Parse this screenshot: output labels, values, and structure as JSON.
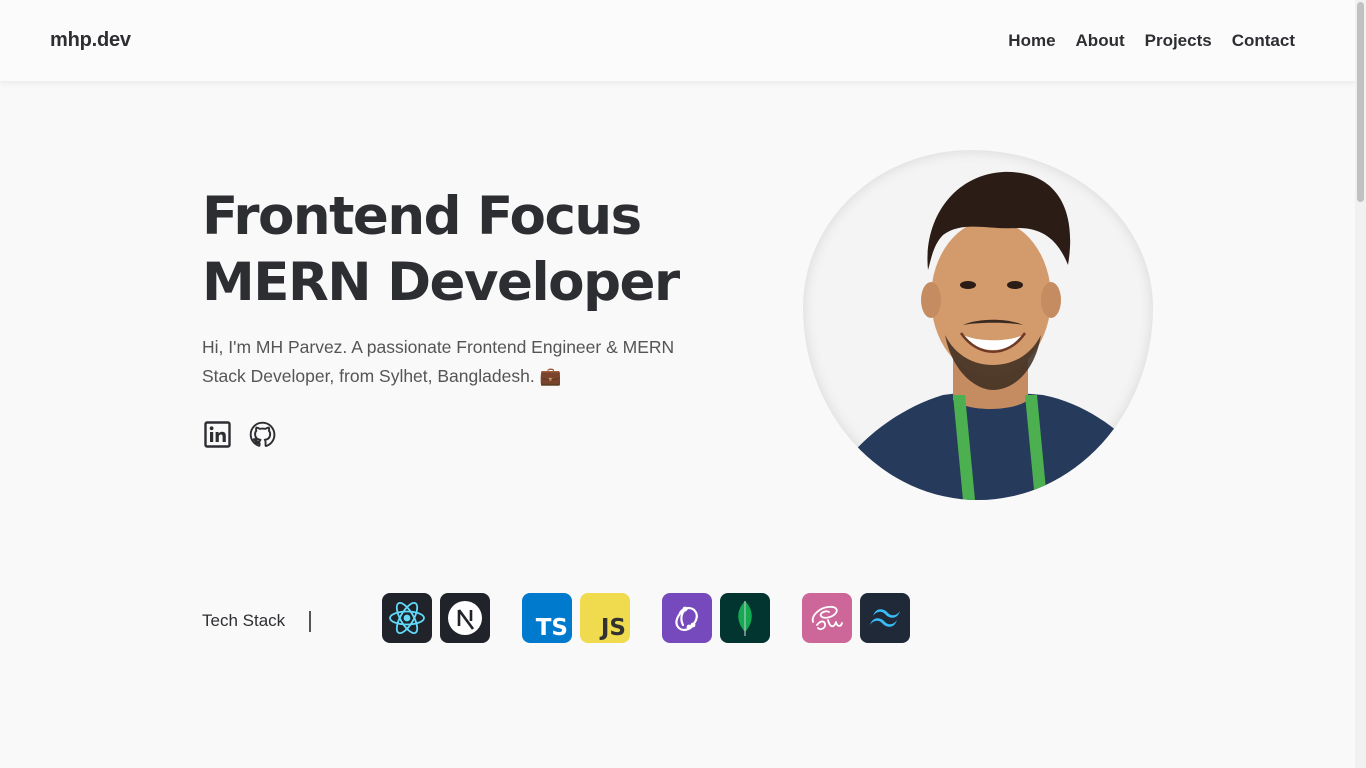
{
  "header": {
    "logo": "mhp.dev",
    "nav": [
      "Home",
      "About",
      "Projects",
      "Contact"
    ]
  },
  "hero": {
    "title_line1": "Frontend Focus",
    "title_line2": "MERN Developer",
    "description": "Hi, I'm MH Parvez. A passionate Frontend Engineer & MERN Stack Developer, from Sylhet, Bangladesh. 💼",
    "socials": [
      "linkedin-icon",
      "github-icon"
    ]
  },
  "tech_stack": {
    "label": "Tech Stack",
    "icons": [
      {
        "name": "react-icon",
        "bg": "#20232a"
      },
      {
        "name": "nextjs-icon",
        "bg": "#20232a"
      },
      {
        "name": "typescript-icon",
        "bg": "#007acc",
        "text": "TS"
      },
      {
        "name": "javascript-icon",
        "bg": "#f0db4f",
        "text": "JS"
      },
      {
        "name": "redux-icon",
        "bg": "#764abc"
      },
      {
        "name": "mongodb-icon",
        "bg": "#023430"
      },
      {
        "name": "sass-icon",
        "bg": "#cd6799"
      },
      {
        "name": "tailwind-icon",
        "bg": "#1f2937"
      }
    ]
  },
  "colors": {
    "text": "#2d2e32",
    "background": "#f9f9f9"
  }
}
